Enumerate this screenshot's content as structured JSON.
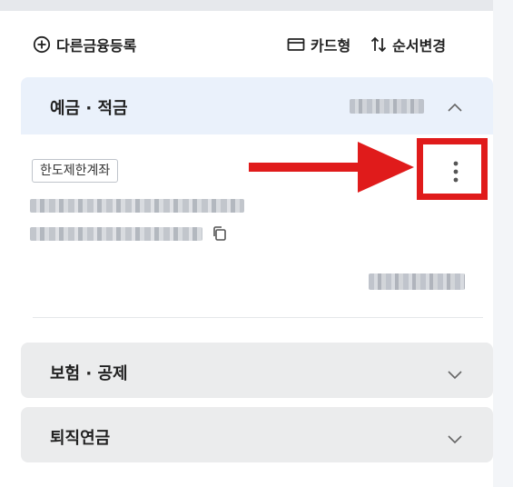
{
  "toolbar": {
    "add_label": "다른금융등록",
    "card_view_label": "카드형",
    "sort_label": "순서변경"
  },
  "sections": {
    "deposit": {
      "title": "예금 · 적금",
      "badge": "한도제한계좌"
    },
    "insurance": {
      "title": "보험 · 공제"
    },
    "pension": {
      "title": "퇴직연금"
    }
  },
  "icons": {
    "add": "plus-circle-icon",
    "card": "card-icon",
    "sort": "sort-arrows-icon",
    "collapse": "chevron-up-icon",
    "expand": "chevron-down-icon",
    "more": "kebab-menu-icon",
    "copy": "copy-icon"
  },
  "colors": {
    "annotation_red": "#e01b1b",
    "section_active_bg": "#eaf1fb",
    "section_collapsed_bg": "#ebeced"
  }
}
